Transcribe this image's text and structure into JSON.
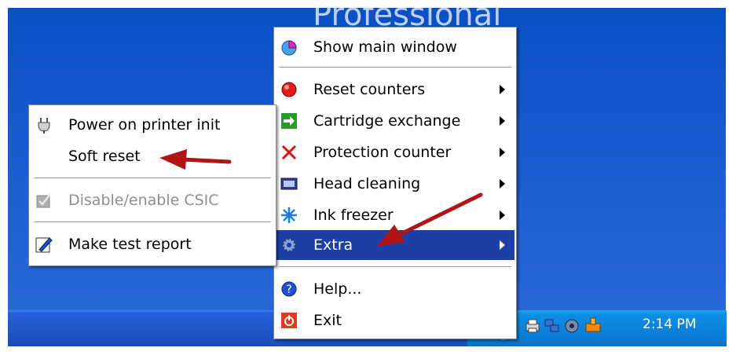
{
  "desktop": {
    "watermark": "Professional"
  },
  "main_menu": {
    "items": [
      {
        "label": "Show main window",
        "icon": "pie-chart-icon"
      },
      {
        "label": "Reset counters",
        "icon": "red-ball-icon",
        "has_submenu": true
      },
      {
        "label": "Cartridge exchange",
        "icon": "green-arrow-icon",
        "has_submenu": true
      },
      {
        "label": "Protection counter",
        "icon": "red-x-icon",
        "has_submenu": true
      },
      {
        "label": "Head cleaning",
        "icon": "head-cleaning-icon",
        "has_submenu": true
      },
      {
        "label": "Ink freezer",
        "icon": "snowflake-icon",
        "has_submenu": true
      },
      {
        "label": "Extra",
        "icon": "gear-icon",
        "has_submenu": true,
        "selected": true
      },
      {
        "label": "Help...",
        "icon": "help-icon"
      },
      {
        "label": "Exit",
        "icon": "power-icon"
      }
    ]
  },
  "sub_menu": {
    "items": [
      {
        "label": "Power on printer init",
        "icon": "plug-icon"
      },
      {
        "label": "Soft reset"
      },
      {
        "label": "Disable/enable CSIC",
        "icon": "checkbox-icon",
        "disabled": true
      },
      {
        "label": "Make test report",
        "icon": "pencil-icon"
      }
    ]
  },
  "taskbar": {
    "clock": "2:14 PM"
  },
  "colors": {
    "desktop": "#1c5ed2",
    "selection": "#1c3fa8",
    "annotation_arrow": "#b01414",
    "tray": "#0c80d9"
  }
}
